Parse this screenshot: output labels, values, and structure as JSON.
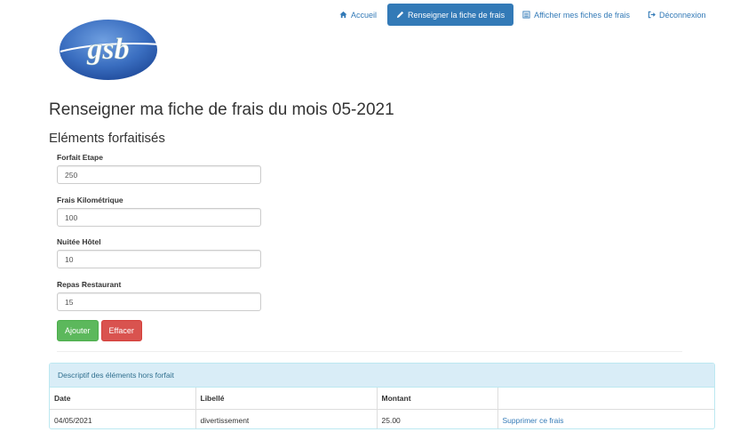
{
  "nav": {
    "items": [
      {
        "label": "Accueil",
        "icon": "home-icon"
      },
      {
        "label": "Renseigner la fiche de frais",
        "icon": "pencil-icon",
        "active": true
      },
      {
        "label": "Afficher mes fiches de frais",
        "icon": "list-icon"
      },
      {
        "label": "Déconnexion",
        "icon": "logout-icon"
      }
    ]
  },
  "logo": {
    "text": "gsb"
  },
  "page": {
    "title": "Renseigner ma fiche de frais du mois 05-2021"
  },
  "forfait": {
    "title": "Eléments forfaitisés",
    "fields": [
      {
        "label": "Forfait Etape",
        "value": "250"
      },
      {
        "label": "Frais Kilométrique",
        "value": "100"
      },
      {
        "label": "Nuitée Hôtel",
        "value": "10"
      },
      {
        "label": "Repas Restaurant",
        "value": "15"
      }
    ],
    "add_label": "Ajouter",
    "clear_label": "Effacer"
  },
  "horsforfait": {
    "heading": "Descriptif des éléments hors forfait",
    "columns": [
      "Date",
      "Libellé",
      "Montant",
      ""
    ],
    "rows": [
      {
        "date": "04/05/2021",
        "libelle": "divertissement",
        "montant": "25.00",
        "action": "Supprimer ce frais"
      }
    ]
  },
  "colors": {
    "primary": "#337ab7",
    "success": "#5cb85c",
    "danger": "#d9534f",
    "info_bg": "#d9edf7"
  }
}
